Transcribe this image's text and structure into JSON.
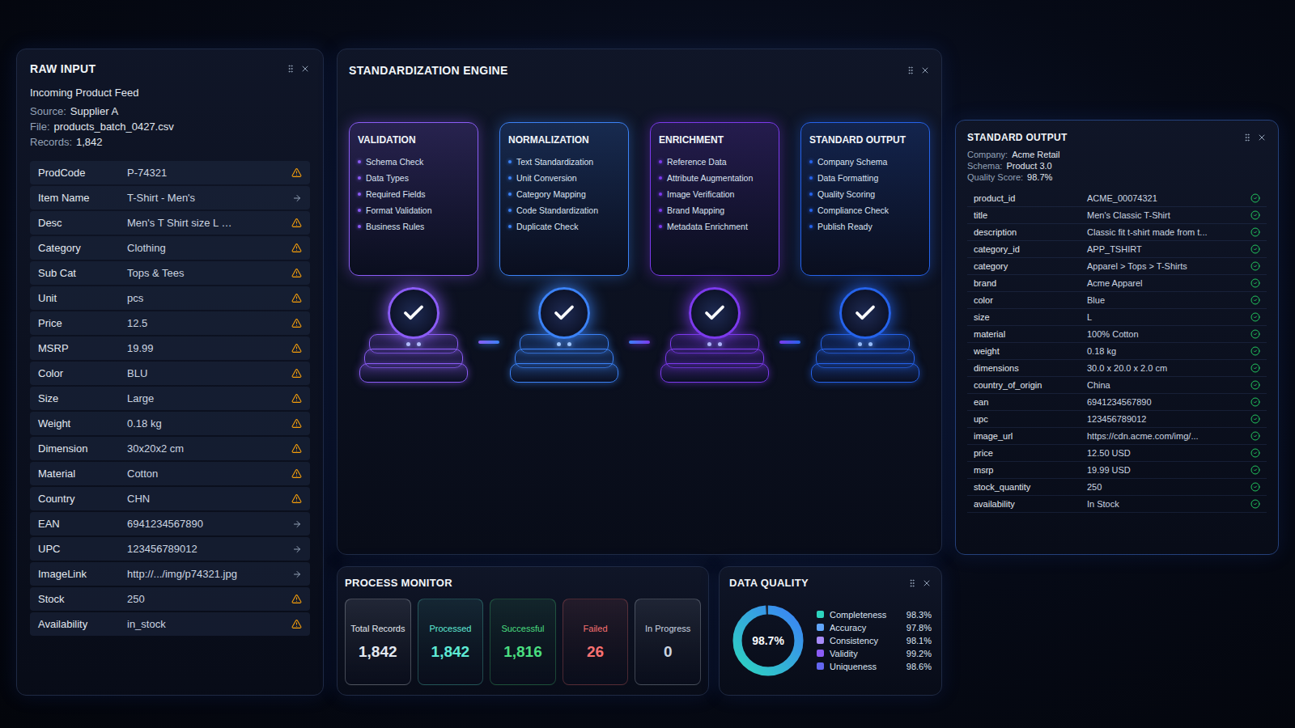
{
  "raw_input": {
    "title": "RAW INPUT",
    "subtitle": "Incoming Product Feed",
    "meta": [
      {
        "label": "Source:",
        "value": "Supplier A"
      },
      {
        "label": "File:",
        "value": "products_batch_0427.csv"
      },
      {
        "label": "Records:",
        "value": "1,842"
      }
    ],
    "rows": [
      {
        "field": "ProdCode",
        "value": "P-74321",
        "warning": true
      },
      {
        "field": "Item Name",
        "value": "T-Shirt - Men's",
        "warning": false
      },
      {
        "field": "Desc",
        "value": "Men's T Shirt size L …",
        "warning": true
      },
      {
        "field": "Category",
        "value": "Clothing",
        "warning": true
      },
      {
        "field": "Sub Cat",
        "value": "Tops & Tees",
        "warning": true
      },
      {
        "field": "Unit",
        "value": "pcs",
        "warning": true
      },
      {
        "field": "Price",
        "value": "12.5",
        "warning": true
      },
      {
        "field": "MSRP",
        "value": "19.99",
        "warning": true
      },
      {
        "field": "Color",
        "value": "BLU",
        "warning": true
      },
      {
        "field": "Size",
        "value": "Large",
        "warning": true
      },
      {
        "field": "Weight",
        "value": "0.18 kg",
        "warning": true
      },
      {
        "field": "Dimension",
        "value": "30x20x2 cm",
        "warning": true
      },
      {
        "field": "Material",
        "value": "Cotton",
        "warning": true
      },
      {
        "field": "Country",
        "value": "CHN",
        "warning": true
      },
      {
        "field": "EAN",
        "value": "6941234567890",
        "warning": false
      },
      {
        "field": "UPC",
        "value": "123456789012",
        "warning": false
      },
      {
        "field": "ImageLink",
        "value": "http://.../img/p74321.jpg",
        "warning": false
      },
      {
        "field": "Stock",
        "value": "250",
        "warning": true
      },
      {
        "field": "Availability",
        "value": "in_stock",
        "warning": true
      }
    ]
  },
  "engine": {
    "title": "STANDARDIZATION ENGINE",
    "stages": [
      {
        "title": "VALIDATION",
        "items": [
          "Schema Check",
          "Data Types",
          "Required Fields",
          "Format Validation",
          "Business Rules"
        ],
        "done": true,
        "color": "#8b5cf6"
      },
      {
        "title": "NORMALIZATION",
        "items": [
          "Text Standardization",
          "Unit Conversion",
          "Category Mapping",
          "Code Standardization",
          "Duplicate Check"
        ],
        "done": true,
        "color": "#3b82f6"
      },
      {
        "title": "ENRICHMENT",
        "items": [
          "Reference Data",
          "Attribute Augmentation",
          "Image Verification",
          "Brand Mapping",
          "Metadata Enrichment"
        ],
        "done": true,
        "color": "#7c3aed"
      },
      {
        "title": "STANDARD OUTPUT",
        "items": [
          "Company Schema",
          "Data Formatting",
          "Quality Scoring",
          "Compliance Check",
          "Publish Ready"
        ],
        "done": true,
        "color": "#2563eb"
      }
    ]
  },
  "output": {
    "title": "STANDARD OUTPUT",
    "meta": [
      {
        "label": "Company:",
        "value": "Acme Retail"
      },
      {
        "label": "Schema:",
        "value": "Product 3.0"
      },
      {
        "label": "Quality Score:",
        "value": "98.7%"
      }
    ],
    "rows": [
      {
        "field": "product_id",
        "value": "ACME_00074321",
        "valid": true
      },
      {
        "field": "title",
        "value": "Men's Classic T-Shirt",
        "valid": true
      },
      {
        "field": "description",
        "value": "Classic fit t-shirt made from t...",
        "valid": true
      },
      {
        "field": "category_id",
        "value": "APP_TSHIRT",
        "valid": true
      },
      {
        "field": "category",
        "value": "Apparel > Tops > T-Shirts",
        "valid": true
      },
      {
        "field": "brand",
        "value": "Acme Apparel",
        "valid": true
      },
      {
        "field": "color",
        "value": "Blue",
        "valid": true
      },
      {
        "field": "size",
        "value": "L",
        "valid": true
      },
      {
        "field": "material",
        "value": "100% Cotton",
        "valid": true
      },
      {
        "field": "weight",
        "value": "0.18 kg",
        "valid": true
      },
      {
        "field": "dimensions",
        "value": "30.0 x 20.0 x 2.0 cm",
        "valid": true
      },
      {
        "field": "country_of_origin",
        "value": "China",
        "valid": true
      },
      {
        "field": "ean",
        "value": "6941234567890",
        "valid": true
      },
      {
        "field": "upc",
        "value": "123456789012",
        "valid": true
      },
      {
        "field": "image_url",
        "value": "https://cdn.acme.com/img/...",
        "valid": true
      },
      {
        "field": "price",
        "value": "12.50 USD",
        "valid": true
      },
      {
        "field": "msrp",
        "value": "19.99 USD",
        "valid": true
      },
      {
        "field": "stock_quantity",
        "value": "250",
        "valid": true
      },
      {
        "field": "availability",
        "value": "In Stock",
        "valid": true
      }
    ]
  },
  "process_monitor": {
    "title": "PROCESS MONITOR",
    "stats": [
      {
        "label": "Total Records",
        "value": "1,842",
        "color": "#e2e8f0"
      },
      {
        "label": "Processed",
        "value": "1,842",
        "color": "#5eead4"
      },
      {
        "label": "Successful",
        "value": "1,816",
        "color": "#4ade80"
      },
      {
        "label": "Failed",
        "value": "26",
        "color": "#f87171"
      },
      {
        "label": "In Progress",
        "value": "0",
        "color": "#cbd5e1"
      }
    ]
  },
  "data_quality": {
    "title": "DATA QUALITY",
    "score": "98.7%",
    "level": 0.987,
    "metrics": [
      {
        "label": "Completeness",
        "value": "98.3%",
        "color": "#2dd4bf"
      },
      {
        "label": "Accuracy",
        "value": "97.8%",
        "color": "#60a5fa"
      },
      {
        "label": "Consistency",
        "value": "98.1%",
        "color": "#a78bfa"
      },
      {
        "label": "Validity",
        "value": "99.2%",
        "color": "#8b5cf6"
      },
      {
        "label": "Uniqueness",
        "value": "98.6%",
        "color": "#6366f1"
      }
    ]
  }
}
